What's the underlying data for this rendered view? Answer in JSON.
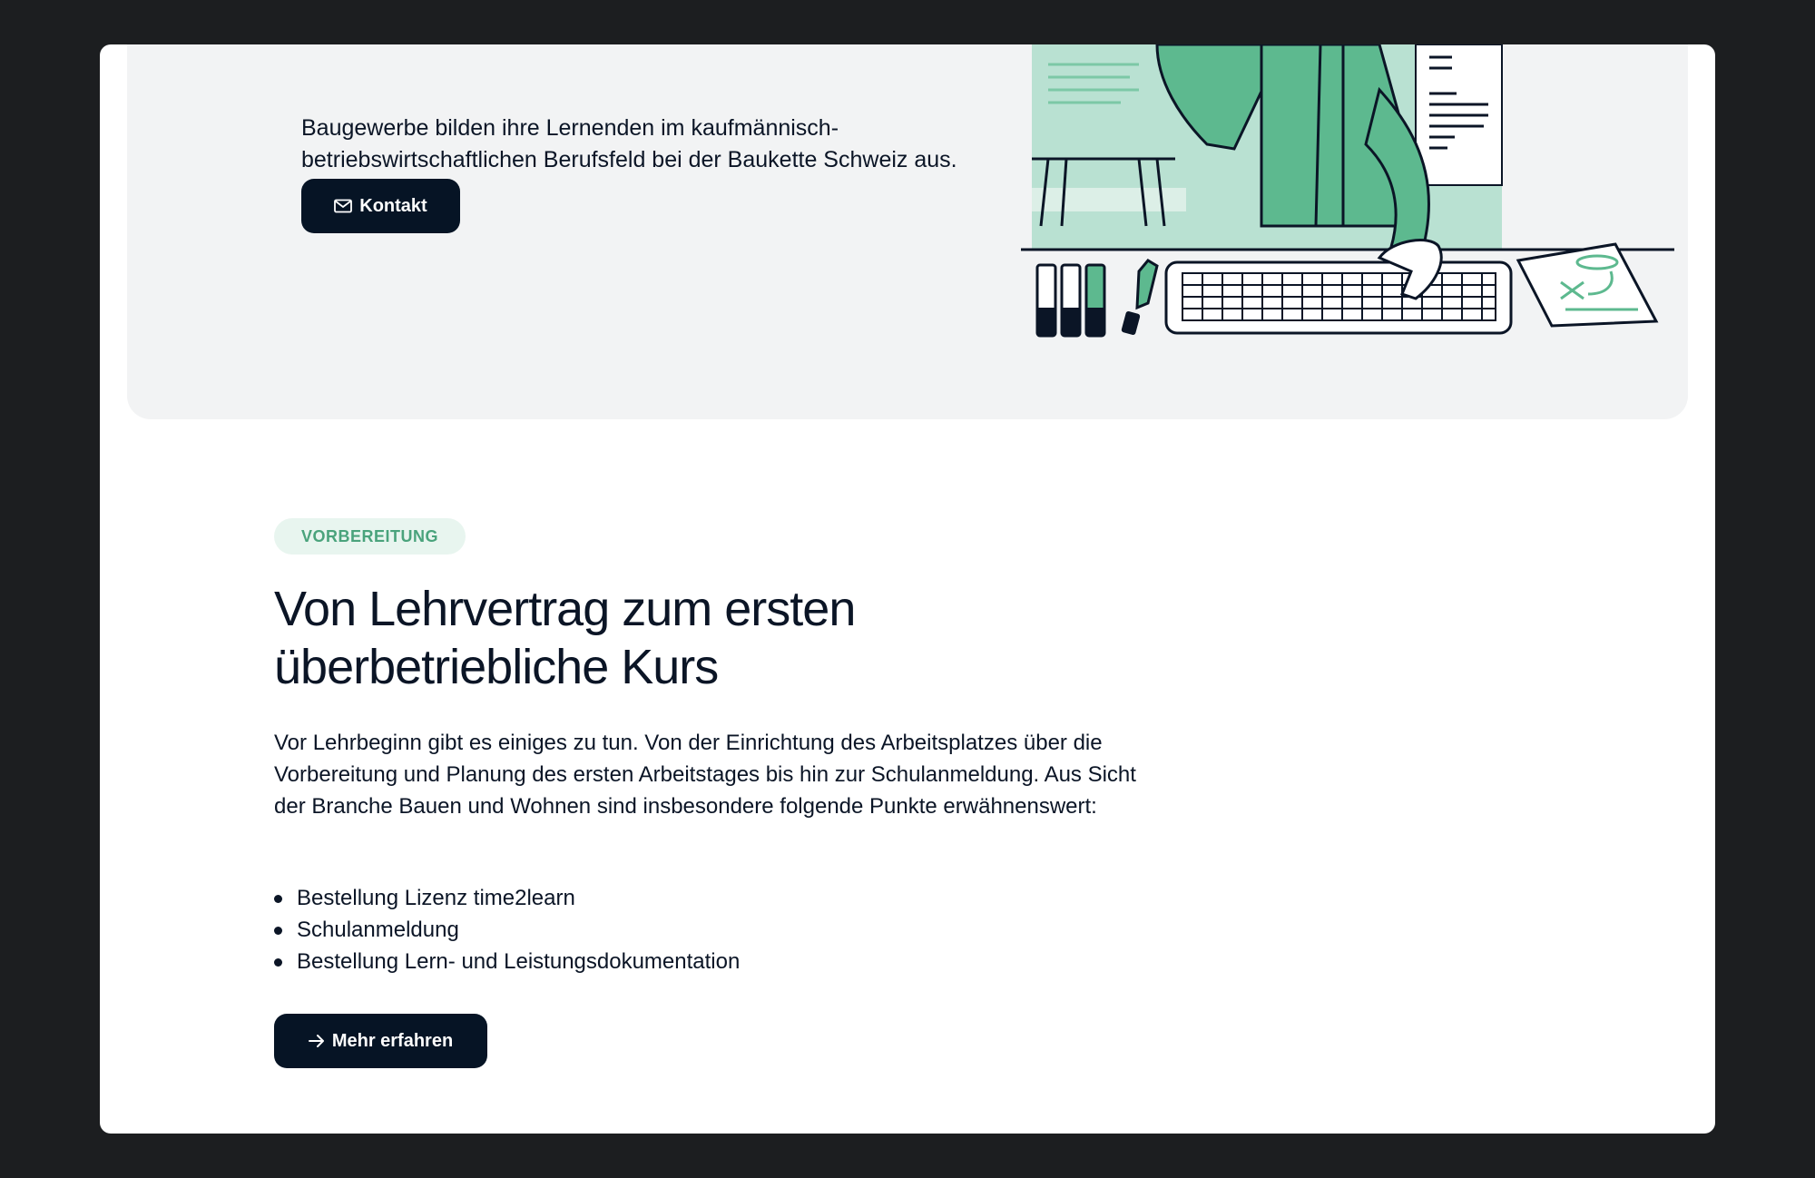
{
  "hero": {
    "text": "Baugewerbe bilden ihre Lernenden im kaufmännisch-betriebswirtschaftlichen Berufsfeld bei der Baukette Schweiz aus.",
    "contact_label": "Kontakt"
  },
  "section": {
    "tag": "VORBEREITUNG",
    "heading": "Von Lehrvertrag zum ersten überbetriebliche Kurs",
    "body": "Vor Lehrbeginn gibt es einiges zu tun. Von der Einrichtung des Arbeitsplatzes über die Vorbereitung und Planung des ersten Arbeitstages bis hin zur Schulanmeldung. Aus Sicht der Branche Bauen und Wohnen sind insbesondere folgende Punkte erwähnenswert:",
    "bullets": [
      "Bestellung Lizenz time2learn",
      "Schulanmeldung",
      "Bestellung Lern- und Leistungsdokumentation"
    ],
    "more_label": "Mehr erfahren"
  },
  "colors": {
    "accent_green": "#4aa37c",
    "button_dark": "#061425",
    "hero_bg": "#f2f3f4",
    "backdrop": "#1c1e20"
  },
  "icons": {
    "contact": "envelope-icon",
    "more": "arrow-right-icon"
  }
}
